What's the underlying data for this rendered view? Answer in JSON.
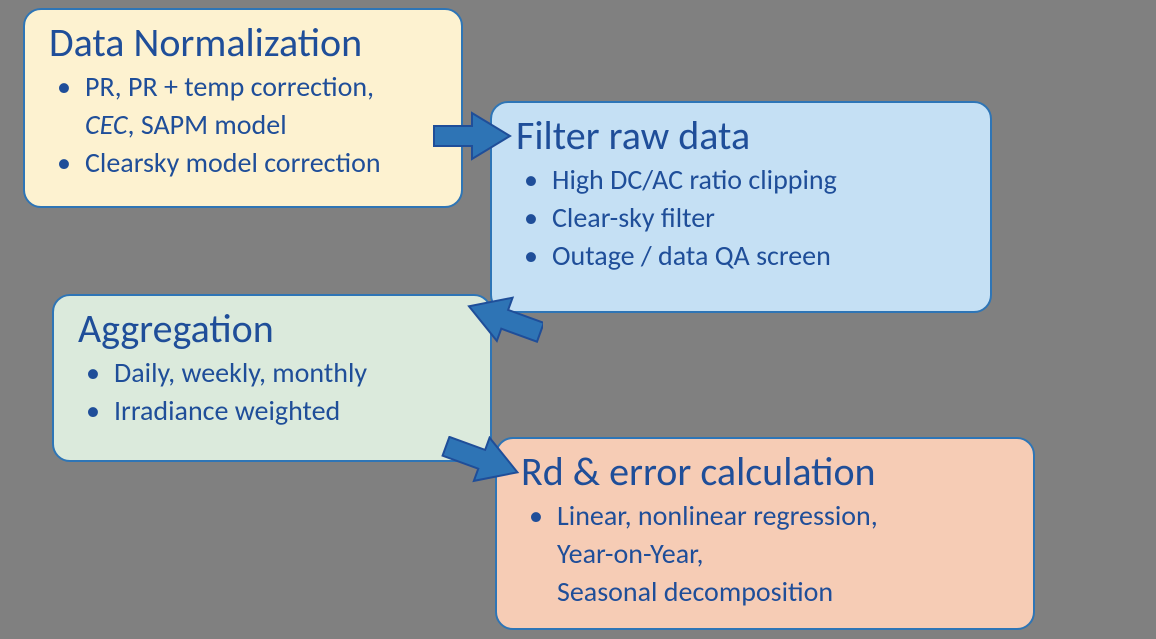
{
  "boxes": {
    "normalization": {
      "title": "Data Normalization",
      "bullet1_a": "PR, PR + temp correction,",
      "bullet1_b_italic": "CEC",
      "bullet1_b_rest": ", SAPM model",
      "bullet2": "Clearsky model correction"
    },
    "filter": {
      "title": "Filter raw data",
      "bullet1": "High DC/AC ratio clipping",
      "bullet2": "Clear-sky filter",
      "bullet3": "Outage / data QA screen"
    },
    "aggregation": {
      "title": "Aggregation",
      "bullet1": "Daily, weekly, monthly",
      "bullet2": "Irradiance weighted"
    },
    "rd": {
      "title": "Rd & error calculation",
      "bullet1_a": "Linear, nonlinear regression,",
      "bullet1_b": "Year-on-Year,",
      "bullet1_c": "Seasonal decomposition"
    }
  },
  "colors": {
    "arrow_fill": "#2e74b5",
    "arrow_stroke": "#1f4e99"
  }
}
